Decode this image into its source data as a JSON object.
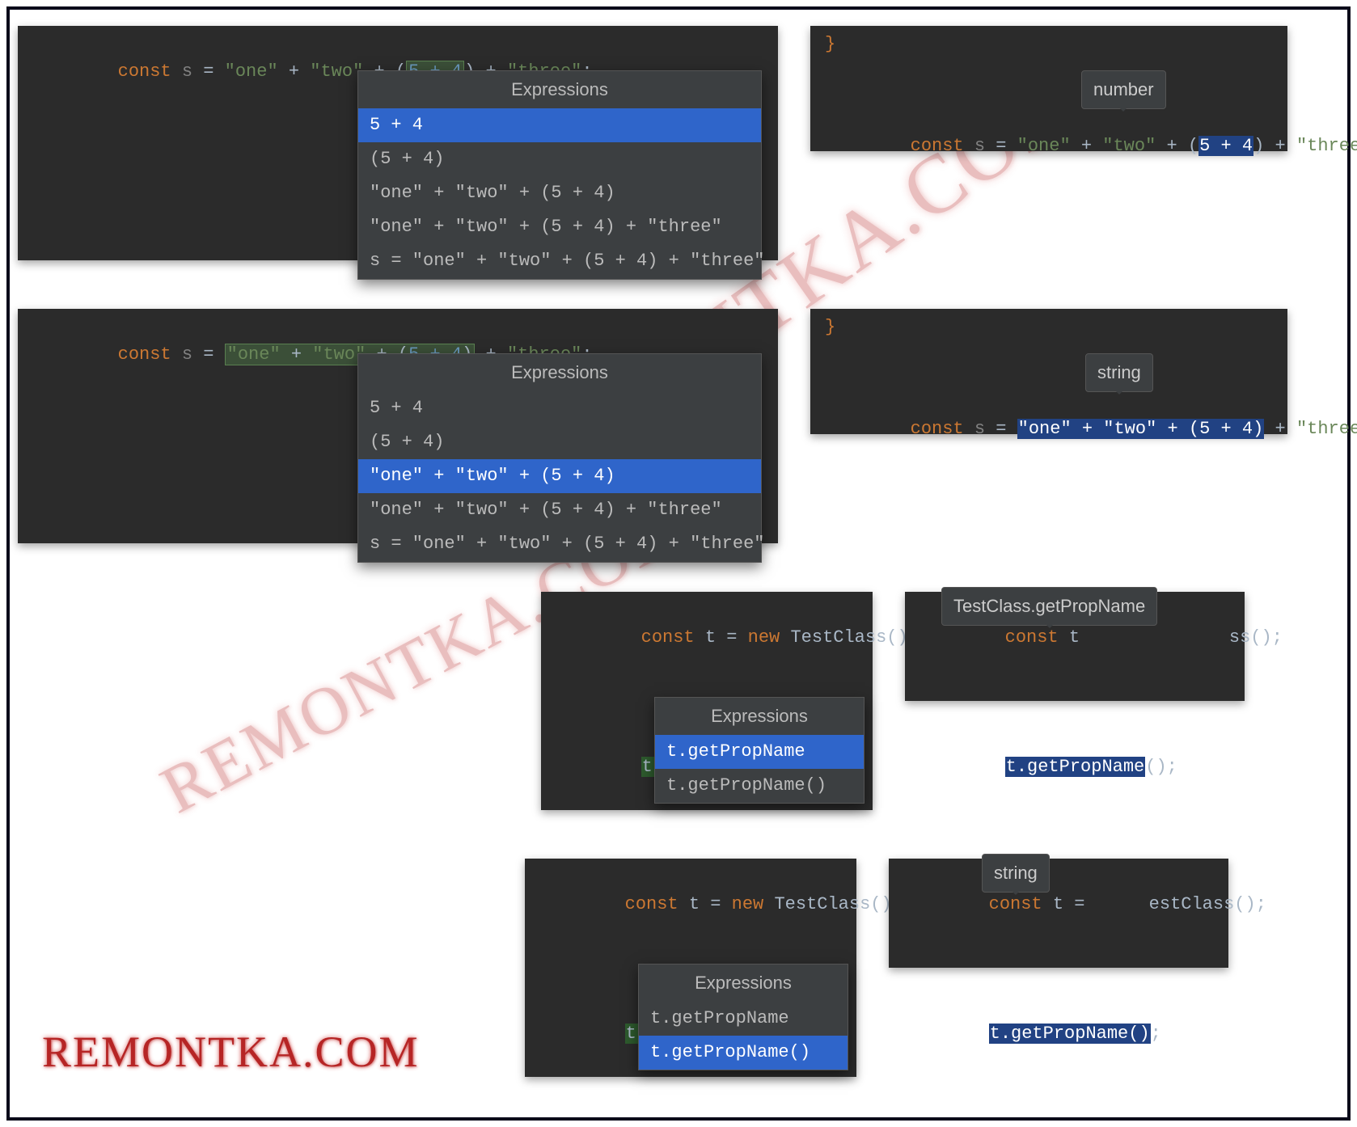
{
  "watermark": "REMONTKA.COM",
  "popup_title": "Expressions",
  "code": {
    "const_kw": "const",
    "var_s": "s",
    "eq": " = ",
    "str_one": "\"one\"",
    "plus": " + ",
    "str_two": "\"two\"",
    "lparen": "(",
    "num_expr": "5 + 4",
    "rparen": ")",
    "str_three": "\"three\"",
    "semi": ";",
    "rbrace": "}",
    "var_t": "t",
    "new_kw": "new",
    "class_name": "TestClass",
    "call_empty": "()",
    "dot": ".",
    "method_name": "getPropName"
  },
  "popup_items": {
    "e1": "5 + 4",
    "e2": "(5 + 4)",
    "e3": "\"one\" + \"two\" + (5 + 4)",
    "e4": "\"one\" + \"two\" + (5 + 4) + \"three\"",
    "e5": "s = \"one\" + \"two\" + (5 + 4) + \"three\"",
    "m1": "t.getPropName",
    "m2": "t.getPropName()"
  },
  "tooltips": {
    "number": "number",
    "string": "string",
    "testclass": "TestClass.getPropName"
  }
}
